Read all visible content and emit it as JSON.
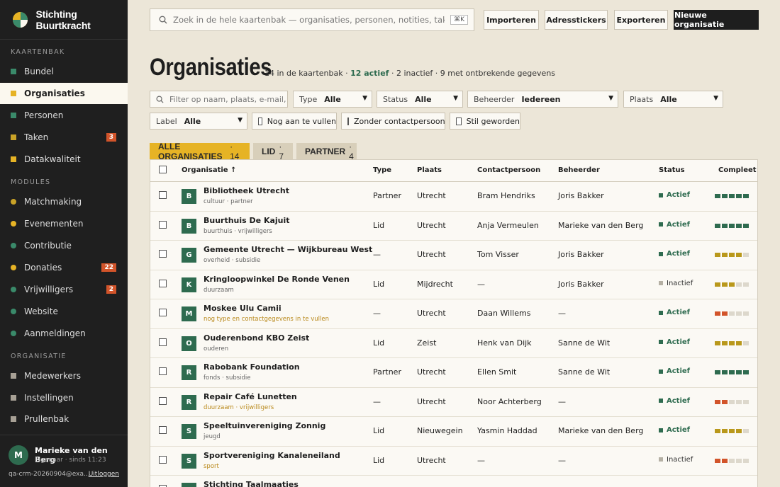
{
  "brand": {
    "name": "Stichting Buurtkracht"
  },
  "sidebar": {
    "sections": [
      {
        "title": "KAARTENBAK",
        "items": [
          {
            "label": "Bundel",
            "icon": "square-icon",
            "color": "#3a8a6a"
          },
          {
            "label": "Organisaties",
            "icon": "square-icon",
            "color": "#e6b325",
            "active": true
          },
          {
            "label": "Personen",
            "icon": "square-icon",
            "color": "#3a8a6a"
          },
          {
            "label": "Taken",
            "icon": "square-icon",
            "color": "#c9a227",
            "badge": "3"
          },
          {
            "label": "Datakwaliteit",
            "icon": "square-icon",
            "color": "#e6b325"
          }
        ]
      },
      {
        "title": "MODULES",
        "items": [
          {
            "label": "Matchmaking",
            "icon": "dot-icon",
            "color": "#c9a227"
          },
          {
            "label": "Evenementen",
            "icon": "dot-icon",
            "color": "#e6b325"
          },
          {
            "label": "Contributie",
            "icon": "dot-icon",
            "color": "#3a8a6a"
          },
          {
            "label": "Donaties",
            "icon": "dot-icon",
            "color": "#e6b325",
            "badge": "22"
          },
          {
            "label": "Vrijwilligers",
            "icon": "dot-icon",
            "color": "#3a8a6a",
            "badge": "2"
          },
          {
            "label": "Website",
            "icon": "dot-icon",
            "color": "#3a8a6a"
          },
          {
            "label": "Aanmeldingen",
            "icon": "dot-icon",
            "color": "#3a8a6a"
          }
        ]
      },
      {
        "title": "ORGANISATIE",
        "items": [
          {
            "label": "Medewerkers",
            "icon": "square-icon",
            "color": "#a7a095"
          },
          {
            "label": "Instellingen",
            "icon": "square-icon",
            "color": "#a7a095"
          },
          {
            "label": "Prullenbak",
            "icon": "square-icon",
            "color": "#a7a095"
          }
        ]
      }
    ]
  },
  "user": {
    "initial": "M",
    "name": "Marieke van den Berg",
    "role": "Eigenaar · sinds 11:23",
    "email": "qa-crm-20260904@exa...",
    "logout": "Uitloggen"
  },
  "search": {
    "placeholder": "Zoek in de hele kaartenbak — organisaties, personen, notities, taken, documenten",
    "shortcut": "⌘K"
  },
  "toolbar": {
    "import": "Importeren",
    "labels": "Adresstickers",
    "export": "Exporteren",
    "new": "Nieuwe organisatie"
  },
  "page": {
    "title": "Organisaties",
    "count": "14 in de kaartenbak · ",
    "active": "12 actief",
    "rest": " · 2 inactief · 9 met ontbrekende gegevens"
  },
  "filters": {
    "search_placeholder": "Filter op naam, plaats, e-mail, KvK",
    "type": {
      "label": "Type",
      "value": "Alle"
    },
    "status": {
      "label": "Status",
      "value": "Alle"
    },
    "owner": {
      "label": "Beheerder",
      "value": "Iedereen"
    },
    "place": {
      "label": "Plaats",
      "value": "Alle"
    },
    "tag": {
      "label": "Label",
      "value": "Alle"
    },
    "chk1": "Nog aan te vullen",
    "chk2": "Zonder contactpersoon",
    "chk3": "Stil geworden"
  },
  "tabs": [
    {
      "label": "ALLE ORGANISATIES",
      "count": "· 14"
    },
    {
      "label": "LID",
      "count": "· 7"
    },
    {
      "label": "PARTNER",
      "count": "· 4"
    }
  ],
  "table": {
    "headers": {
      "name": "Organisatie ↑",
      "type": "Type",
      "place": "Plaats",
      "contact": "Contactpersoon",
      "owner": "Beheerder",
      "status": "Status",
      "complete": "Compleet"
    },
    "rows": [
      {
        "ini": "B",
        "name": "Bibliotheek Utrecht",
        "tags": "cultuur · partner",
        "warn": false,
        "type": "Partner",
        "place": "Utrecht",
        "contact": "Bram Hendriks",
        "owner": "Joris Bakker",
        "status": "Actief",
        "active": true,
        "score": 5,
        "color": "#2e6b4f"
      },
      {
        "ini": "B",
        "name": "Buurthuis De Kajuit",
        "tags": "buurthuis · vrijwilligers",
        "warn": false,
        "type": "Lid",
        "place": "Utrecht",
        "contact": "Anja Vermeulen",
        "owner": "Marieke van den Berg",
        "status": "Actief",
        "active": true,
        "score": 5,
        "color": "#2e6b4f"
      },
      {
        "ini": "G",
        "name": "Gemeente Utrecht — Wijkbureau West",
        "tags": "overheid · subsidie",
        "warn": false,
        "type": "—",
        "place": "Utrecht",
        "contact": "Tom Visser",
        "owner": "Joris Bakker",
        "status": "Actief",
        "active": true,
        "score": 4,
        "color": "#b9981b"
      },
      {
        "ini": "K",
        "name": "Kringloopwinkel De Ronde Venen",
        "tags": "duurzaam",
        "warn": false,
        "type": "Lid",
        "place": "Mijdrecht",
        "contact": "—",
        "owner": "Joris Bakker",
        "status": "Inactief",
        "active": false,
        "score": 3,
        "color": "#b9981b"
      },
      {
        "ini": "M",
        "name": "Moskee Ulu Camii",
        "tags": "nog type en contactgegevens in te vullen",
        "warn": true,
        "type": "—",
        "place": "Utrecht",
        "contact": "Daan Willems",
        "owner": "—",
        "status": "Actief",
        "active": true,
        "score": 2,
        "color": "#d2542a"
      },
      {
        "ini": "O",
        "name": "Ouderenbond KBO Zeist",
        "tags": "ouderen",
        "warn": false,
        "type": "Lid",
        "place": "Zeist",
        "contact": "Henk van Dijk",
        "owner": "Sanne de Wit",
        "status": "Actief",
        "active": true,
        "score": 4,
        "color": "#b9981b"
      },
      {
        "ini": "R",
        "name": "Rabobank Foundation",
        "tags": "fonds · subsidie",
        "warn": false,
        "type": "Partner",
        "place": "Utrecht",
        "contact": "Ellen Smit",
        "owner": "Sanne de Wit",
        "status": "Actief",
        "active": true,
        "score": 5,
        "color": "#2e6b4f"
      },
      {
        "ini": "R",
        "name": "Repair Café Lunetten",
        "tags": "duurzaam · vrijwilligers",
        "warn": true,
        "type": "—",
        "place": "Utrecht",
        "contact": "Noor Achterberg",
        "owner": "—",
        "status": "Actief",
        "active": true,
        "score": 2,
        "color": "#d2542a"
      },
      {
        "ini": "S",
        "name": "Speeltuinvereniging Zonnig",
        "tags": "jeugd",
        "warn": false,
        "type": "Lid",
        "place": "Nieuwegein",
        "contact": "Yasmin Haddad",
        "owner": "Marieke van den Berg",
        "status": "Actief",
        "active": true,
        "score": 4,
        "color": "#b9981b"
      },
      {
        "ini": "S",
        "name": "Sportvereniging Kanaleneiland",
        "tags": "sport",
        "warn": true,
        "type": "Lid",
        "place": "Utrecht",
        "contact": "—",
        "owner": "—",
        "status": "Inactief",
        "active": false,
        "score": 2,
        "color": "#d2542a"
      },
      {
        "ini": "S",
        "name": "Stichting Taalmaatjes",
        "tags": "",
        "warn": false,
        "type": "",
        "place": "",
        "contact": "",
        "owner": "",
        "status": "",
        "active": true,
        "score": 0,
        "color": "#2e6b4f"
      }
    ]
  }
}
